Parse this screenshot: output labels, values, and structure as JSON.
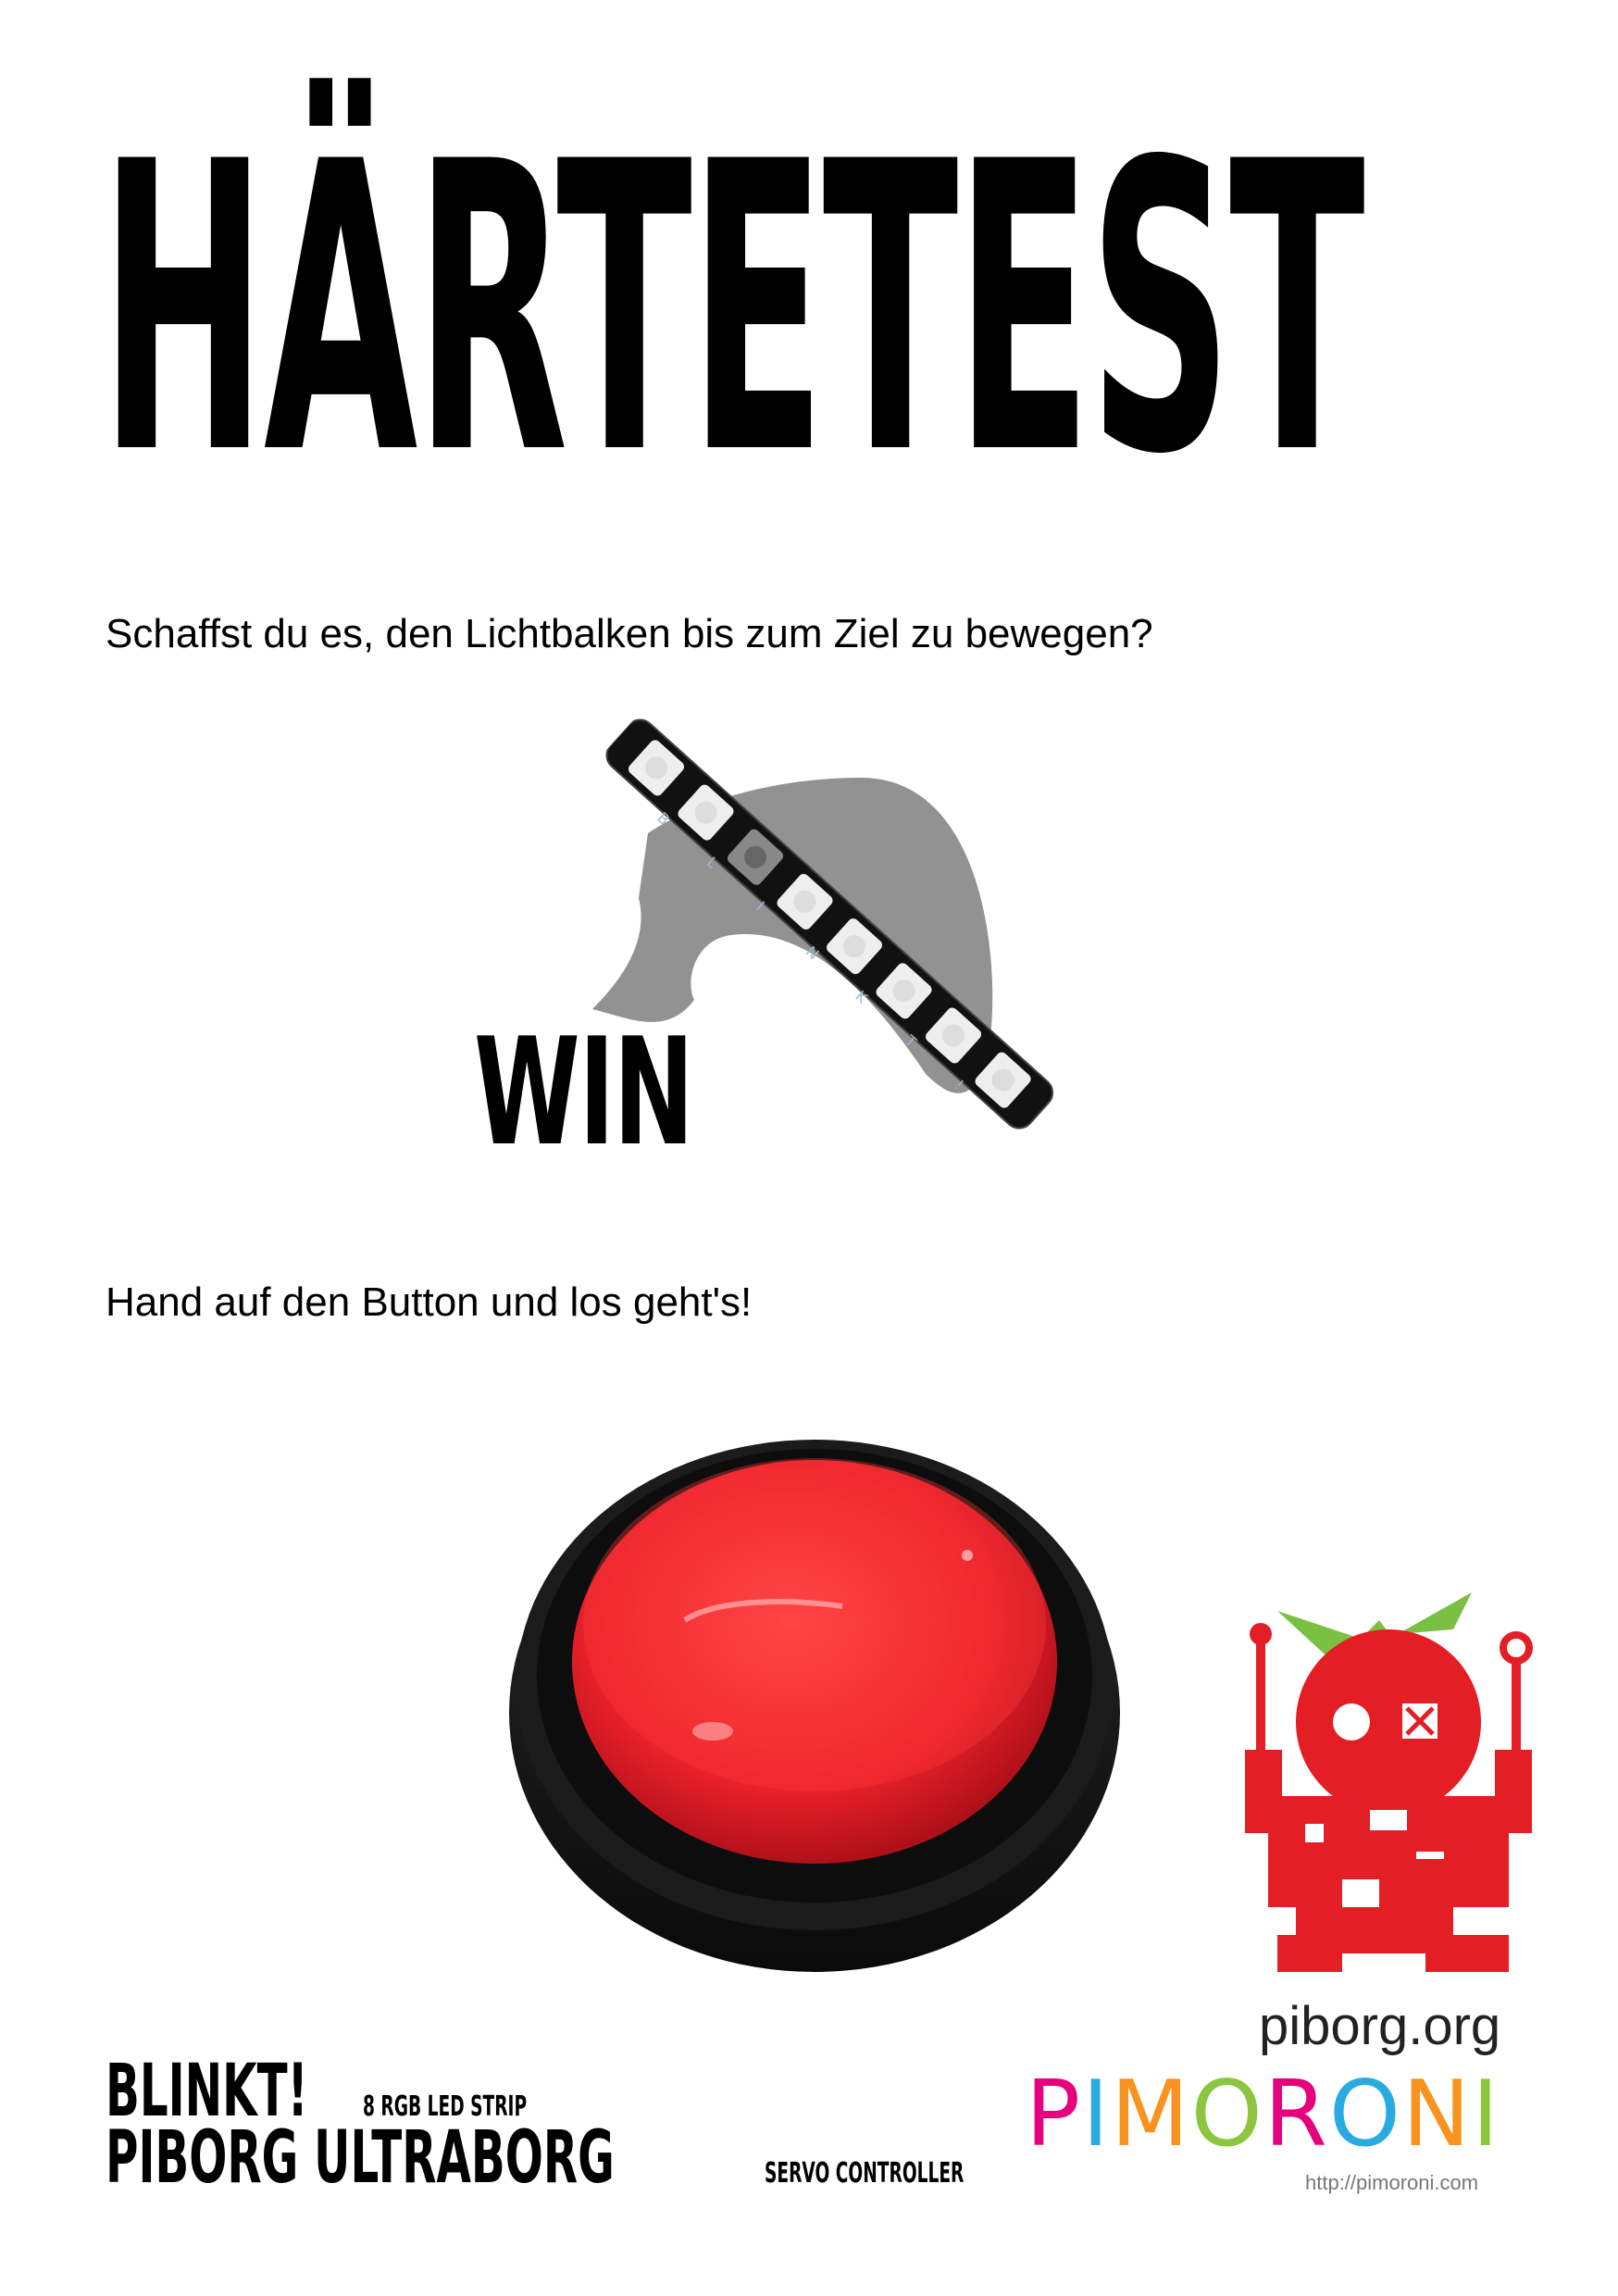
{
  "title": "HÄRTETEST",
  "lead_question": "Schaffst du es, den Lichtbalken bis zum Ziel zu bewegen?",
  "win_label": "WIN",
  "blinkt_letters": [
    "B",
    "L",
    "I",
    "N",
    "K",
    "T",
    "!"
  ],
  "lead_start": "Hand auf den Button und los geht's!",
  "credits": [
    {
      "name": "BLINKT!",
      "detail": "8 RGB LED STRIP"
    },
    {
      "name": "PIBORG ULTRABORG",
      "detail": "SERVO CONTROLLER"
    }
  ],
  "piborg": {
    "url": "piborg.org"
  },
  "pimoroni": {
    "letters": [
      "P",
      "I",
      "M",
      "O",
      "R",
      "O",
      "N",
      "I"
    ],
    "letter_colors": [
      "#e6007e",
      "#29abe2",
      "#f7931e",
      "#8cc63f",
      "#e6007e",
      "#29abe2",
      "#f7931e",
      "#8cc63f"
    ],
    "url": "http://pimoroni.com"
  },
  "colors": {
    "button_red": "#e8202a",
    "robot_red": "#e31e24",
    "leaf_green": "#7ac143",
    "arrow_gray": "#8c8c8c"
  }
}
